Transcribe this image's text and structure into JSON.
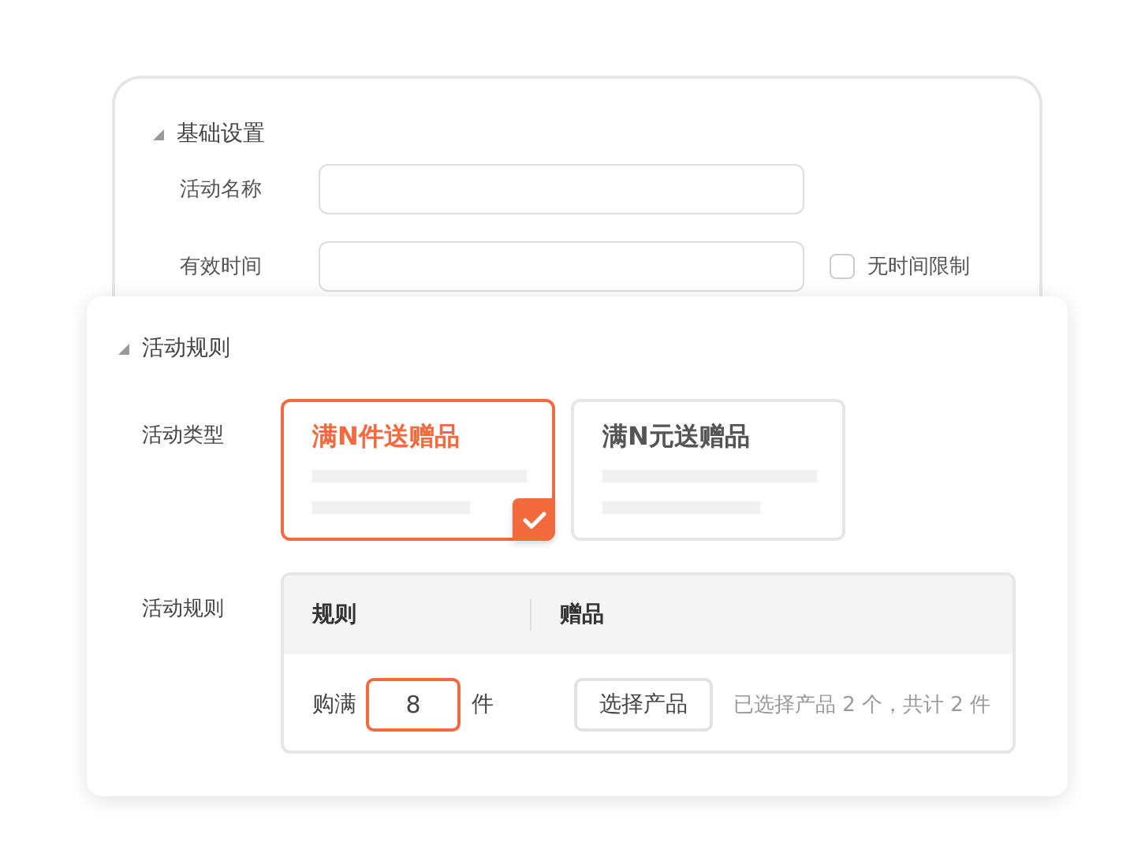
{
  "basic_settings": {
    "title": "基础设置",
    "expanded": true,
    "fields": [
      {
        "label": "活动名称"
      },
      {
        "label": "有效时间",
        "checkbox": {
          "label": "无时间限制",
          "checked": false
        }
      }
    ]
  },
  "activity_rules": {
    "title": "活动规则",
    "expanded": true,
    "type_label": "活动类型",
    "types": [
      {
        "title": "满N件送赠品",
        "selected": true
      },
      {
        "title": "满N元送赠品",
        "selected": false
      }
    ],
    "rules_label": "活动规则",
    "table": {
      "columns": [
        "规则",
        "赠品"
      ],
      "row": {
        "prefix": "购满",
        "quantity": "8",
        "unit": "件",
        "button": "选择产品",
        "note": "已选择产品 2 个，共计 2 件"
      }
    }
  }
}
